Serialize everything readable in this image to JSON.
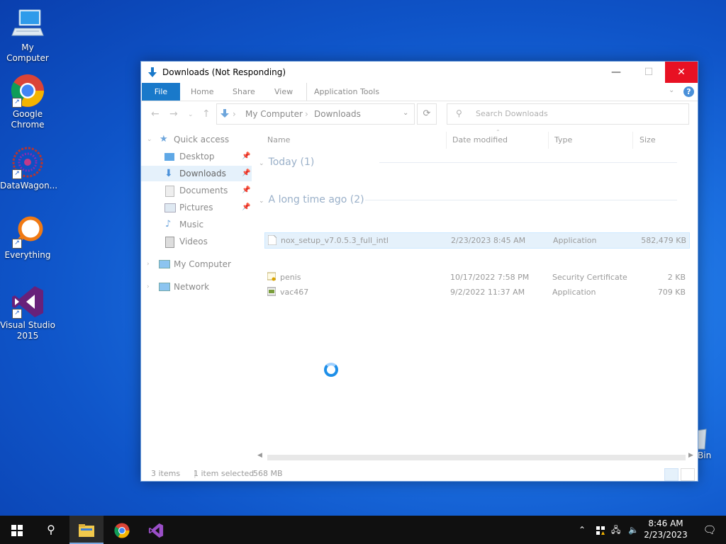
{
  "desktop": {
    "icons": [
      {
        "label": "My Computer"
      },
      {
        "label": "Google Chrome"
      },
      {
        "label": "DataWagon..."
      },
      {
        "label": "Everything"
      },
      {
        "label": "Visual Studio 2015"
      }
    ],
    "recycle_bin_partial_label": "Bin"
  },
  "window": {
    "title": "Downloads (Not Responding)",
    "buttons": {
      "minimize": "—",
      "maximize": "☐",
      "close": "✕"
    },
    "ribbon": {
      "tabs": [
        "File",
        "Home",
        "Share",
        "View",
        "Application Tools"
      ],
      "help": "?"
    },
    "address": {
      "crumbs": [
        "My Computer",
        "Downloads"
      ],
      "separator": "›"
    },
    "search_placeholder": "Search Downloads",
    "nav": {
      "quick_access": "Quick access",
      "items": [
        "Desktop",
        "Downloads",
        "Documents",
        "Pictures",
        "Music",
        "Videos"
      ],
      "my_computer": "My Computer",
      "network": "Network"
    },
    "columns": [
      "Name",
      "Date modified",
      "Type",
      "Size"
    ],
    "groups": [
      {
        "title": "Today (1)",
        "files": [
          {
            "name": "nox_setup_v7.0.5.3_full_intl",
            "date": "2/23/2023 8:45 AM",
            "type": "Application",
            "size": "582,479 KB",
            "selected": true
          }
        ]
      },
      {
        "title": "A long time ago (2)",
        "files": [
          {
            "name": "penis",
            "date": "10/17/2022 7:58 PM",
            "type": "Security Certificate",
            "size": "2 KB",
            "selected": false
          },
          {
            "name": "vac467",
            "date": "9/2/2022 11:37 AM",
            "type": "Application",
            "size": "709 KB",
            "selected": false
          }
        ]
      }
    ],
    "status": {
      "items": "3 items",
      "selected": "1 item selected",
      "size": "568 MB"
    }
  },
  "taskbar": {
    "time": "8:46 AM",
    "date": "2/23/2023"
  },
  "colors": {
    "accent": "#1979ca",
    "close_red": "#e81123",
    "selection": "#e5f1fb"
  }
}
